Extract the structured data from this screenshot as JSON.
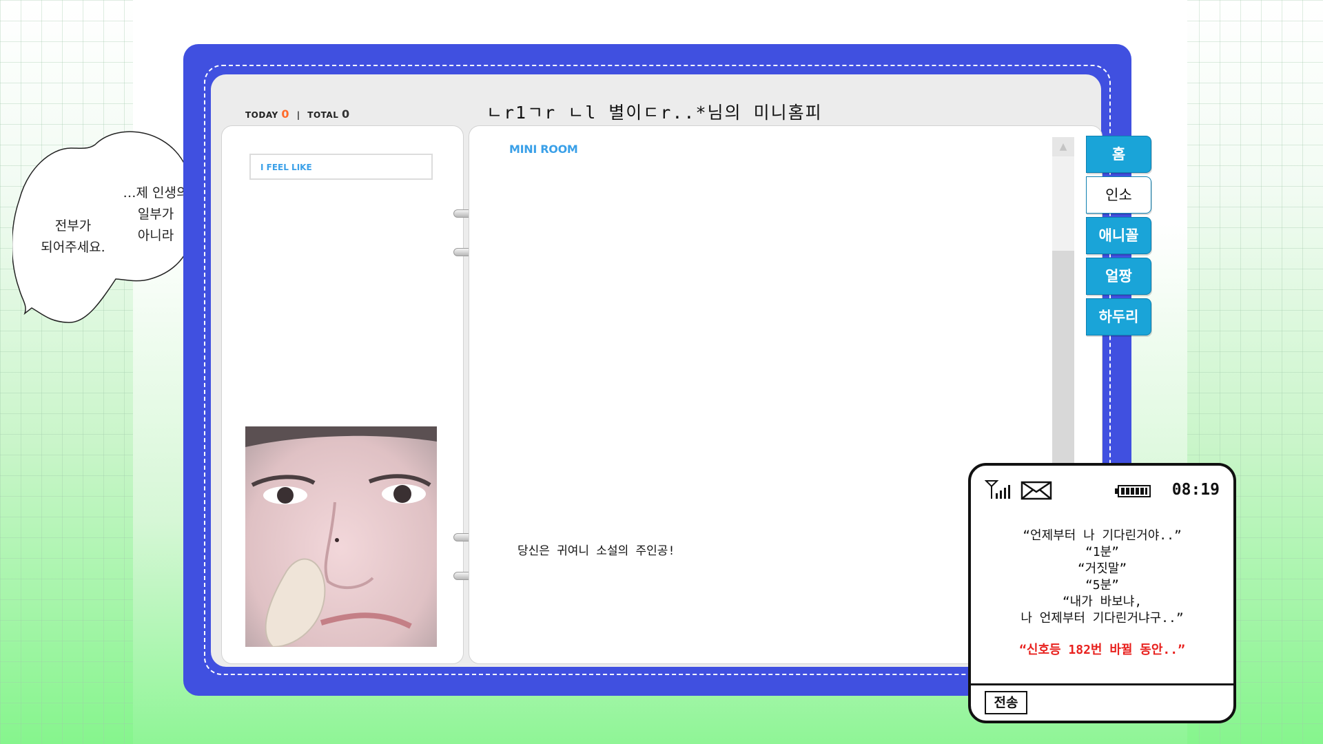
{
  "counter": {
    "today_label": "TODAY",
    "today_value": "0",
    "separator": "|",
    "total_label": "TOTAL",
    "total_value": "0"
  },
  "home_title": "ㄴr1ㄱr ㄴl 별이ㄷr..*님의 미니홈피",
  "feel_like": "I FEEL LIKE",
  "mini_room": {
    "label": "MINI ROOM",
    "caption": "당신은 귀여니 소설의 주인공!"
  },
  "bubble": {
    "line_a": [
      "…제 인생의",
      "일부가",
      "아니라"
    ],
    "line_b": [
      "전부가",
      "되어주세요."
    ]
  },
  "tabs": [
    {
      "label": "홈",
      "active": false
    },
    {
      "label": "인소",
      "active": true
    },
    {
      "label": "애니꼴",
      "active": false
    },
    {
      "label": "얼짱",
      "active": false
    },
    {
      "label": "하두리",
      "active": false
    }
  ],
  "phone": {
    "time": "08:19",
    "signal_icon": "antenna-icon",
    "mail_icon": "envelope-icon",
    "battery_icon": "battery-icon",
    "messages": [
      "“언제부터 나 기다린거야..”",
      "“1분”",
      "“거짓말”",
      "“5분”",
      "“내가 바보냐,",
      "나 언제부터 기다린거냐구..”"
    ],
    "highlight": "“신호등 182번 바뀔 동안..”",
    "send_label": "전송"
  },
  "colors": {
    "frame": "#4050e0",
    "tab": "#1aa4d8",
    "accent": "#3aa0e8",
    "counter_today": "#ff6a2a",
    "highlight": "#e8211e"
  }
}
